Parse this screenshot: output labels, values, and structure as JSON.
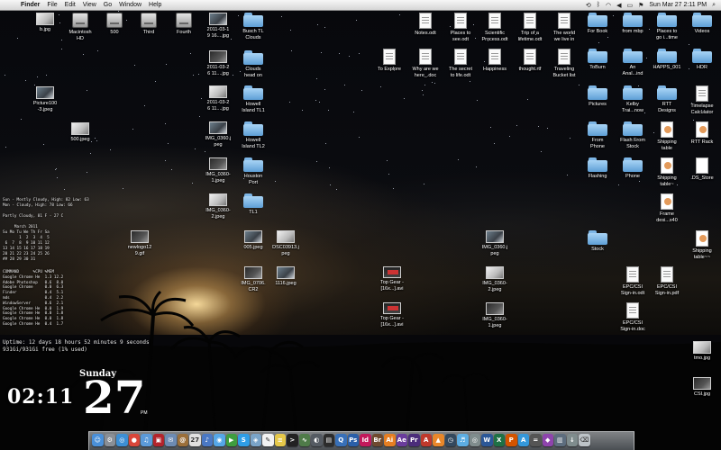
{
  "menubar": {
    "apple": "",
    "items": [
      "Finder",
      "File",
      "Edit",
      "View",
      "Go",
      "Window",
      "Help"
    ],
    "status_icons": [
      "time-machine-icon",
      "bluetooth-icon",
      "wifi-icon",
      "volume-icon",
      "battery-icon",
      "flag-icon"
    ],
    "clock": "Sun Mar 27  2:11 PM",
    "spotlight": "search-icon"
  },
  "icons": [
    {
      "label": "b.jpg",
      "type": "img"
    },
    {
      "label": "Macintosh\nHD",
      "type": "drive"
    },
    {
      "label": "500",
      "type": "drive"
    },
    {
      "label": "Third",
      "type": "drive"
    },
    {
      "label": "Fourth",
      "type": "drive"
    },
    {
      "label": "2011-03-1\n9 16....jpg",
      "type": "img"
    },
    {
      "label": "Busch TL\nClouds",
      "type": "folder"
    },
    {
      "label": "2011-03-2\n6 11....jpg",
      "type": "img"
    },
    {
      "label": "Clouds\nhead on",
      "type": "folder"
    },
    {
      "label": "2011-03-2\n6 11....jpg",
      "type": "img"
    },
    {
      "label": "Howell\nIsland TL1",
      "type": "folder"
    },
    {
      "label": "IMG_0360.j\npeg",
      "type": "img"
    },
    {
      "label": "Howell\nIsland TL2",
      "type": "folder"
    },
    {
      "label": "IMG_0360-\n1.jpeg",
      "type": "img"
    },
    {
      "label": "Houston\nPort",
      "type": "folder"
    },
    {
      "label": "IMG_0360-\n2.jpeg",
      "type": "img"
    },
    {
      "label": "TL1",
      "type": "folder"
    },
    {
      "label": "Picture100\n-3.jpeg",
      "type": "img"
    },
    {
      "label": "500.jpeg",
      "type": "img"
    },
    {
      "label": "newlogo12\n9.gif",
      "type": "img"
    },
    {
      "label": "005.jpeg",
      "type": "img"
    },
    {
      "label": "DSC03913.j\npeg",
      "type": "img"
    },
    {
      "label": "IMG_0706.\nCR2",
      "type": "img"
    },
    {
      "label": "1116.jpeg",
      "type": "img"
    },
    {
      "label": "Top Gear -\n[16x...].avi",
      "type": "video"
    },
    {
      "label": "Top Gear -\n[16x...].avi",
      "type": "video"
    },
    {
      "label": "IMG_0360.j\npeg",
      "type": "img"
    },
    {
      "label": "IMG_0360-\n2.jpeg",
      "type": "img"
    },
    {
      "label": "IMG_0360-\n1.jpeg",
      "type": "img"
    },
    {
      "label": "Notes.odt",
      "type": "doc"
    },
    {
      "label": "Places to\nsee.odt",
      "type": "doc"
    },
    {
      "label": "Scientific\nProcess.odt",
      "type": "doc"
    },
    {
      "label": "Trip of a\nlifetime.odt",
      "type": "doc"
    },
    {
      "label": "The world\nwe live in",
      "type": "doc"
    },
    {
      "label": "To Explore",
      "type": "doc"
    },
    {
      "label": "Why are we\nhere_.doc",
      "type": "doc"
    },
    {
      "label": "The secret\nto life.odt",
      "type": "doc"
    },
    {
      "label": "Happiness",
      "type": "doc"
    },
    {
      "label": "thought.rtf",
      "type": "doc"
    },
    {
      "label": "Traveling\nBucket list",
      "type": "doc"
    },
    {
      "label": "For Book",
      "type": "folder"
    },
    {
      "label": "from mbp",
      "type": "folder"
    },
    {
      "label": "Places to\ngo i...time",
      "type": "folder"
    },
    {
      "label": "Videos",
      "type": "folder"
    },
    {
      "label": "ToBurn",
      "type": "folder"
    },
    {
      "label": "An\nAnal...ind",
      "type": "folder"
    },
    {
      "label": "HAPPS_001",
      "type": "folder"
    },
    {
      "label": "HDR",
      "type": "folder"
    },
    {
      "label": "Pictures",
      "type": "folder"
    },
    {
      "label": "Kelby\nTrai...now",
      "type": "folder"
    },
    {
      "label": "RTT\nDesigns",
      "type": "folder"
    },
    {
      "label": "Timelapse\nCalculator",
      "type": "doc"
    },
    {
      "label": "From\nPhone",
      "type": "folder"
    },
    {
      "label": "Flash From\nStock",
      "type": "folder"
    },
    {
      "label": "Shipping\ntable",
      "type": "pages"
    },
    {
      "label": "RTT Rack",
      "type": "pages"
    },
    {
      "label": "Flashing",
      "type": "folder"
    },
    {
      "label": "Phone",
      "type": "folder"
    },
    {
      "label": "Shipping\ntable~",
      "type": "pages"
    },
    {
      "label": ".DS_Store",
      "type": "blank"
    },
    {
      "label": "Frame\ndesi...x40",
      "type": "pages"
    },
    {
      "label": "Stock",
      "type": "folder"
    },
    {
      "label": "Shipping\ntable~~",
      "type": "pages"
    },
    {
      "label": "EPC/CSI\nSign-in.odt",
      "type": "doc"
    },
    {
      "label": "EPC/CSI\nSign-in.pdf",
      "type": "doc"
    },
    {
      "label": "EPC/CSI\nSign-in.doc",
      "type": "doc"
    },
    {
      "label": "tmo.jpg",
      "type": "img"
    },
    {
      "label": "CSI.jpg",
      "type": "img"
    }
  ],
  "widgets": {
    "weather": "Sun - Mostly Cloudy, High: 82 Low: 63\nMon - Cloudy, High: 78 Low: 66\n\nPartly Cloudy, 81 F - 27 C",
    "calendar": "     March 2011\nSu Mo Tu We Th Fr Sa\n       1  2  3  4  5\n 6  7  8  9 10 11 12\n13 14 15 16 17 18 19\n20 21 22 23 24 25 26\n## 28 29 30 31",
    "processes": "COMMAND      %CPU %MEM\nGoogle Chrome He  1.3 12.2\nAdobe Photoshop   0.6  8.0\nGoogle Chrome     0.0  6.3\nFinder            0.4  5.1\nmds               0.4  2.2\nWindowServer      0.6  2.1\nGoogle Chrome He  0.0  1.9\nGoogle Chrome He  0.0  1.8\nGoogle Chrome He  0.0  1.8\nGoogle Chrome He  0.4  1.7",
    "uptime": "Uptime: 12 days 18 hours 52 minutes 9 seconds\n931Gi/931Gi free (1% used)",
    "clock": "02:11",
    "weekday": "Sunday",
    "day": "27",
    "ampm": "PM"
  },
  "dock": [
    {
      "name": "finder-icon",
      "color": "#4a90d9",
      "glyph": "☺"
    },
    {
      "name": "system-preferences-icon",
      "color": "#8a8f96",
      "glyph": "⚙"
    },
    {
      "name": "safari-icon",
      "color": "#3d8fd4",
      "glyph": "◎"
    },
    {
      "name": "chrome-icon",
      "color": "#d9463a",
      "glyph": "●"
    },
    {
      "name": "itunes-icon",
      "color": "#5b9ad9",
      "glyph": "♫"
    },
    {
      "name": "photo-booth-icon",
      "color": "#b3242c",
      "glyph": "▣"
    },
    {
      "name": "mail-icon",
      "color": "#6d8bb3",
      "glyph": "✉"
    },
    {
      "name": "address-book-icon",
      "color": "#9b6f3a",
      "glyph": "@"
    },
    {
      "name": "ical-icon",
      "color": "#e0e0e0",
      "glyph": "27"
    },
    {
      "name": "itunes-store-icon",
      "color": "#4a78c4",
      "glyph": "♪"
    },
    {
      "name": "messages-icon",
      "color": "#55a7e8",
      "glyph": "◉"
    },
    {
      "name": "facetime-icon",
      "color": "#3f9e3f",
      "glyph": "▶"
    },
    {
      "name": "skype-icon",
      "color": "#2f9ee6",
      "glyph": "S"
    },
    {
      "name": "preview-icon",
      "color": "#7aa4c8",
      "glyph": "◈"
    },
    {
      "name": "textedit-icon",
      "color": "#f2f2f2",
      "glyph": "✎"
    },
    {
      "name": "notes-icon",
      "color": "#e5c84a",
      "glyph": "≡"
    },
    {
      "name": "terminal-icon",
      "color": "#222222",
      "glyph": ">"
    },
    {
      "name": "activity-monitor-icon",
      "color": "#4f7b49",
      "glyph": "∿"
    },
    {
      "name": "camera-icon",
      "color": "#555b63",
      "glyph": "◐"
    },
    {
      "name": "clapper-icon",
      "color": "#2c2c2c",
      "glyph": "▤"
    },
    {
      "name": "quicktime-icon",
      "color": "#3870b8",
      "glyph": "Q"
    },
    {
      "name": "photoshop-icon",
      "color": "#2a5fa8",
      "glyph": "Ps"
    },
    {
      "name": "indesign-icon",
      "color": "#c2185b",
      "glyph": "Id"
    },
    {
      "name": "bridge-icon",
      "color": "#6f4a2f",
      "glyph": "Br"
    },
    {
      "name": "illustrator-icon",
      "color": "#e67e22",
      "glyph": "Ai"
    },
    {
      "name": "after-effects-icon",
      "color": "#6a3c9c",
      "glyph": "Ae"
    },
    {
      "name": "premiere-icon",
      "color": "#4b2d7a",
      "glyph": "Pr"
    },
    {
      "name": "acrobat-icon",
      "color": "#c0392b",
      "glyph": "A"
    },
    {
      "name": "vlc-icon",
      "color": "#e8872a",
      "glyph": "▲"
    },
    {
      "name": "dashboard-icon",
      "color": "#34495e",
      "glyph": "◷"
    },
    {
      "name": "itunes-library-icon",
      "color": "#5dade2",
      "glyph": "♬"
    },
    {
      "name": "aperture-icon",
      "color": "#7f8c8d",
      "glyph": "◎"
    },
    {
      "name": "word-icon",
      "color": "#2b5797",
      "glyph": "W"
    },
    {
      "name": "excel-icon",
      "color": "#1e7145",
      "glyph": "X"
    },
    {
      "name": "powerpoint-icon",
      "color": "#d35400",
      "glyph": "P"
    },
    {
      "name": "app-store-icon",
      "color": "#3498db",
      "glyph": "A"
    },
    {
      "name": "calculator-icon",
      "color": "#555555",
      "glyph": "="
    },
    {
      "name": "application-icon",
      "color": "#8e44ad",
      "glyph": "◆"
    },
    {
      "name": "documents-stack-icon",
      "color": "#5d6d7e",
      "glyph": "▥"
    },
    {
      "name": "downloads-stack-icon",
      "color": "#7f8c8d",
      "glyph": "↓"
    },
    {
      "name": "trash-icon",
      "color": "#bdc3c7",
      "glyph": "⌫"
    }
  ]
}
